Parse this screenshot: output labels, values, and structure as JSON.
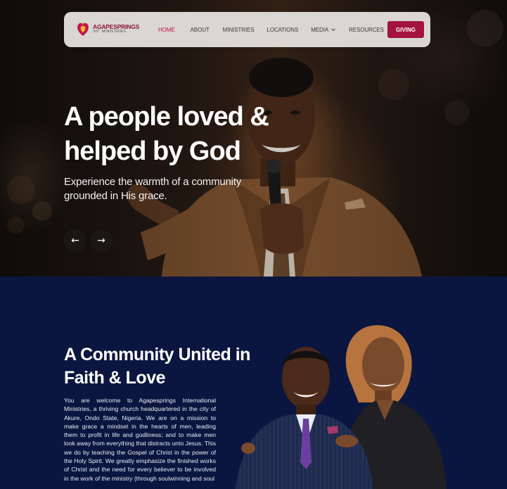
{
  "nav": {
    "logo_name": "AGAPESPRINGS",
    "logo_sub": "INT. MINISTRIES",
    "links": [
      "HOME",
      "ABOUT",
      "MINISTRIES",
      "LOCATIONS",
      "MEDIA",
      "RESOURCES"
    ],
    "active": "HOME",
    "giving_label": "GIVING"
  },
  "hero": {
    "title": "A people loved & helped by God",
    "subtitle": "Experience the warmth of a community grounded in His grace.",
    "prev_arrow": "←",
    "next_arrow": "→"
  },
  "about": {
    "title": "A Community United in Faith & Love",
    "body": "You are welcome to Agapesprings International Ministries, a thriving church headquartered in the city of Akure, Ondo State, Nigeria. We are on a mission to make grace a mindset in the hearts of men, leading them to profit in life and godliness; and to make men look away from everything that distracts unto Jesus. This we do by teaching the Gospel of Christ in the power of the Holy Spirit. We greatly emphasize the finished works of Christ and the need for every believer to be involved in the work of the ministry (through soulwinning and soul"
  },
  "colors": {
    "accent": "#a3133f",
    "active_link": "#c21843",
    "navy": "#0b1640"
  },
  "icons": {
    "logo": "flame-heart-logo",
    "media_dropdown": "chevron-down-icon",
    "prev": "arrow-left-icon",
    "next": "arrow-right-icon"
  }
}
